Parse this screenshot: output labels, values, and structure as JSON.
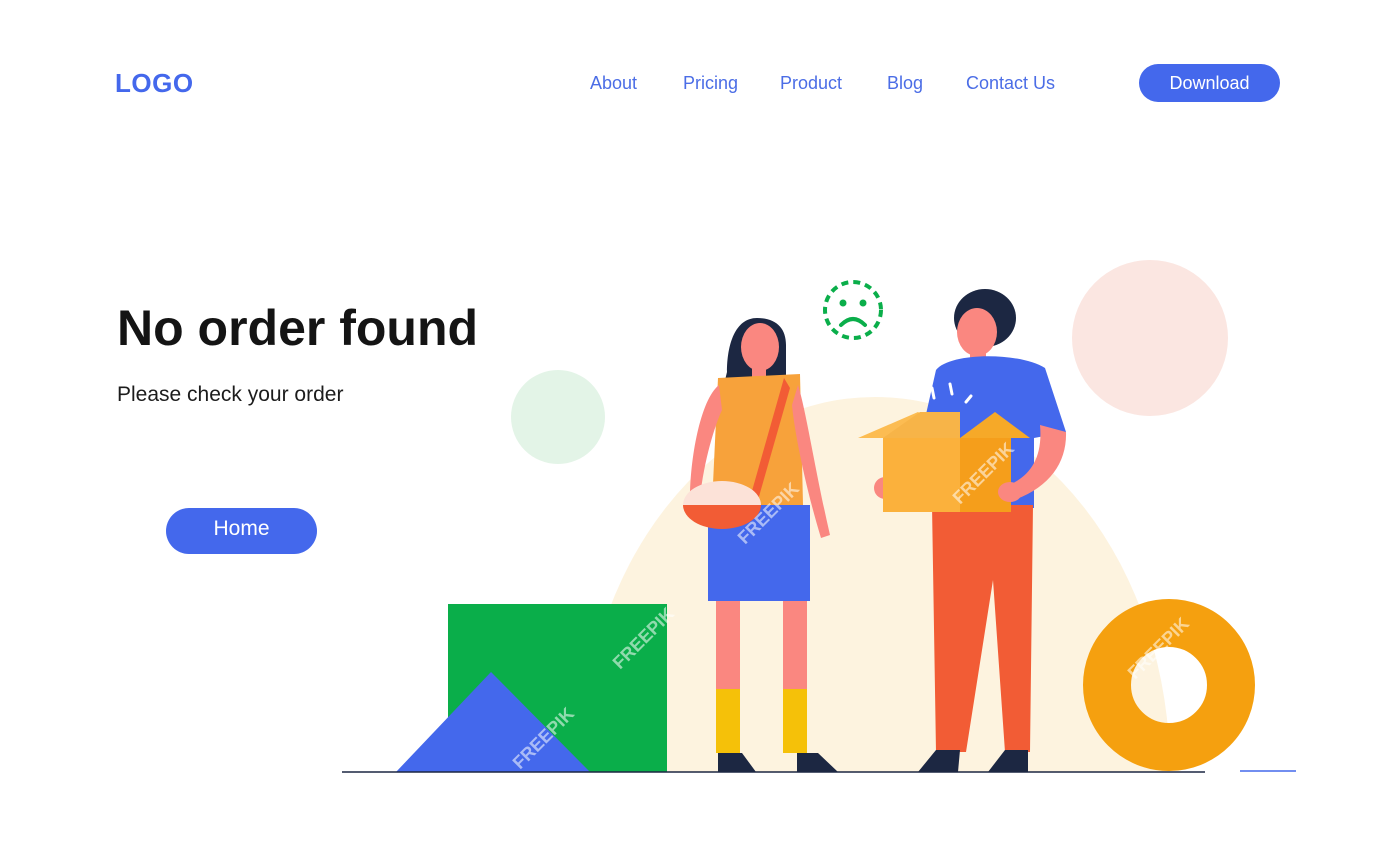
{
  "header": {
    "logo": "LOGO",
    "nav": [
      {
        "label": "About"
      },
      {
        "label": "Pricing"
      },
      {
        "label": "Product"
      },
      {
        "label": "Blog"
      },
      {
        "label": "Contact Us"
      }
    ],
    "cta_label": "Download"
  },
  "hero": {
    "title": "No order found",
    "subtitle": "Please check your order",
    "button_label": "Home"
  },
  "illustration": {
    "icon": "sad-face-icon",
    "watermark": "FREEPIK"
  },
  "colors": {
    "brand_blue": "#4468ec",
    "green": "#0aae4a",
    "orange": "#f5a00f",
    "coral": "#f25c35",
    "cream": "#fdf3df",
    "pale_green": "#e3f4e7",
    "pale_pink": "#fbe6e1",
    "ink": "#141414"
  }
}
